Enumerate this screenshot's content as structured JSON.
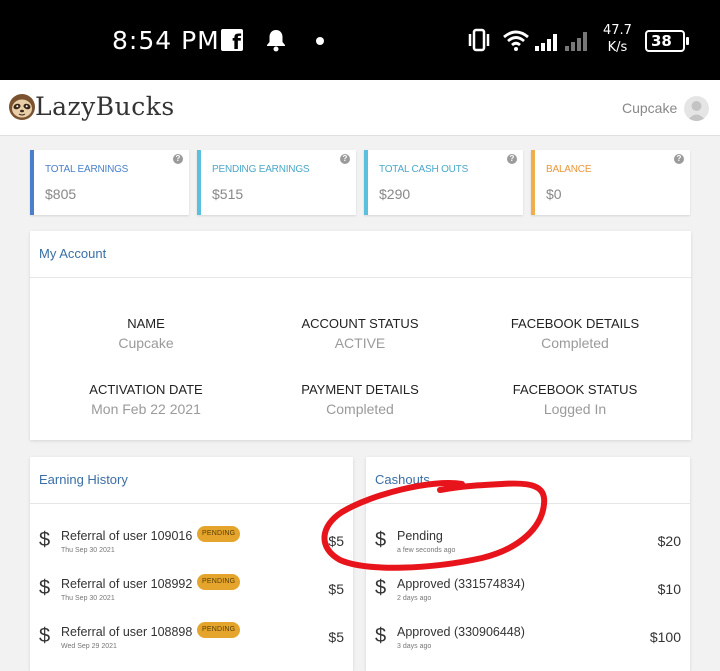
{
  "statusbar": {
    "time": "8:54 PM",
    "speed_value": "47.7",
    "speed_unit": "K/s",
    "battery": "38",
    "icons": [
      "facebook-icon",
      "bell-icon",
      "dot-icon",
      "vibrate-icon",
      "wifi-icon",
      "signal-icon",
      "battery-icon"
    ]
  },
  "header": {
    "brand": "LazyBucks",
    "user_name": "Cupcake",
    "logo_icon": "sloth-logo-icon",
    "avatar_icon": "user-avatar-icon"
  },
  "stats": [
    {
      "label": "TOTAL EARNINGS",
      "value": "$805",
      "color": "#4a7fcb"
    },
    {
      "label": "PENDING EARNINGS",
      "value": "$515",
      "color": "#5bc0de"
    },
    {
      "label": "TOTAL CASH OUTS",
      "value": "$290",
      "color": "#5bc0de"
    },
    {
      "label": "BALANCE",
      "value": "$0",
      "color": "#f0ad4e"
    }
  ],
  "account": {
    "title": "My Account",
    "fields": [
      {
        "label": "NAME",
        "value": "Cupcake"
      },
      {
        "label": "ACCOUNT STATUS",
        "value": "ACTIVE"
      },
      {
        "label": "FACEBOOK DETAILS",
        "value": "Completed"
      },
      {
        "label": "ACTIVATION DATE",
        "value": "Mon Feb 22 2021"
      },
      {
        "label": "PAYMENT DETAILS",
        "value": "Completed"
      },
      {
        "label": "FACEBOOK STATUS",
        "value": "Logged In"
      }
    ]
  },
  "earning_history": {
    "title": "Earning History",
    "rows": [
      {
        "symbol": "$",
        "title": "Referral of user 109016",
        "status": "PENDING",
        "date": "Thu Sep 30 2021",
        "amount": "$5"
      },
      {
        "symbol": "$",
        "title": "Referral of user 108992",
        "status": "PENDING",
        "date": "Thu Sep 30 2021",
        "amount": "$5"
      },
      {
        "symbol": "$",
        "title": "Referral of user 108898",
        "status": "PENDING",
        "date": "Wed Sep 29 2021",
        "amount": "$5"
      }
    ]
  },
  "cashouts": {
    "title": "Cashouts",
    "rows": [
      {
        "symbol": "$",
        "title": "Pending",
        "date": "a few seconds ago",
        "amount": "$20"
      },
      {
        "symbol": "$",
        "title": "Approved (331574834)",
        "date": "2 days ago",
        "amount": "$10"
      },
      {
        "symbol": "$",
        "title": "Approved (330906448)",
        "date": "3 days ago",
        "amount": "$100"
      }
    ]
  },
  "colors": {
    "accent_title": "#3a6ea5",
    "badge": "#e5a52c",
    "annotation": "#e8141b"
  }
}
